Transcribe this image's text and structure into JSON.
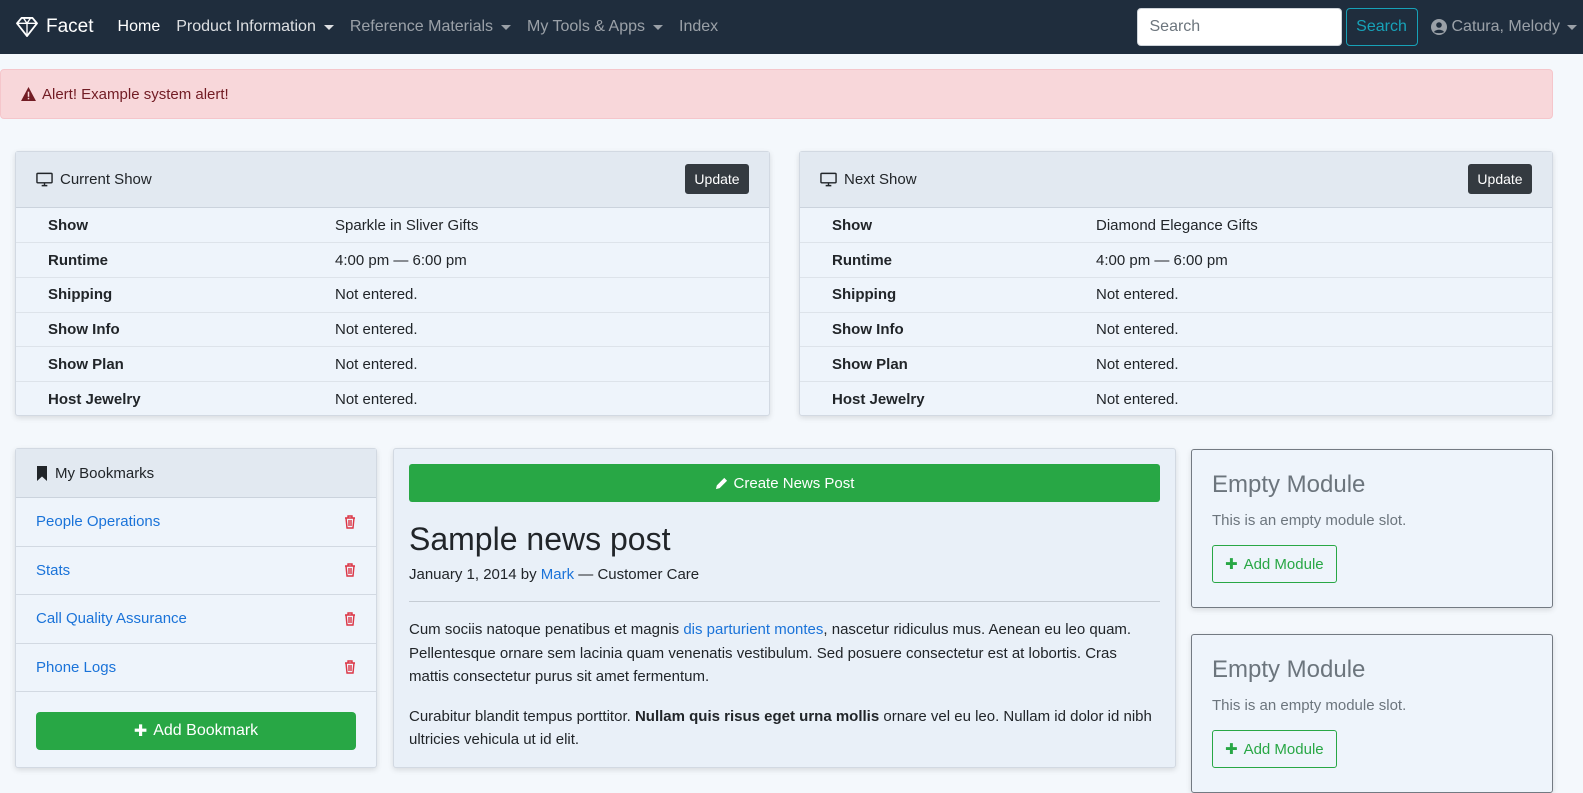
{
  "navbar": {
    "brand": "Facet",
    "links": [
      {
        "label": "Home"
      },
      {
        "label": "Product Information"
      },
      {
        "label": "Reference Materials"
      },
      {
        "label": "My Tools & Apps"
      },
      {
        "label": "Index"
      }
    ],
    "search_placeholder": "Search",
    "search_button": "Search",
    "user_name": "Catura, Melody"
  },
  "alert": {
    "text": "Alert! Example system alert!"
  },
  "current_show": {
    "title": "Current Show",
    "update_label": "Update",
    "rows": [
      {
        "label": "Show",
        "value": "Sparkle in Sliver Gifts"
      },
      {
        "label": "Runtime",
        "value": "4:00 pm — 6:00 pm"
      },
      {
        "label": "Shipping",
        "value": "Not entered."
      },
      {
        "label": "Show Info",
        "value": "Not entered."
      },
      {
        "label": "Show Plan",
        "value": "Not entered."
      },
      {
        "label": "Host Jewelry",
        "value": "Not entered."
      }
    ]
  },
  "next_show": {
    "title": "Next Show",
    "update_label": "Update",
    "rows": [
      {
        "label": "Show",
        "value": "Diamond Elegance Gifts"
      },
      {
        "label": "Runtime",
        "value": "4:00 pm — 6:00 pm"
      },
      {
        "label": "Shipping",
        "value": "Not entered."
      },
      {
        "label": "Show Info",
        "value": "Not entered."
      },
      {
        "label": "Show Plan",
        "value": "Not entered."
      },
      {
        "label": "Host Jewelry",
        "value": "Not entered."
      }
    ]
  },
  "bookmarks": {
    "title": "My Bookmarks",
    "items": [
      {
        "label": "People Operations"
      },
      {
        "label": "Stats"
      },
      {
        "label": "Call Quality Assurance"
      },
      {
        "label": "Phone Logs"
      }
    ],
    "add_label": "Add Bookmark"
  },
  "news": {
    "create_label": "Create News Post",
    "title": "Sample news post",
    "date": "January 1, 2014",
    "by": "by",
    "author": "Mark",
    "department": "— Customer Care",
    "p1_before": "Cum sociis natoque penatibus et magnis ",
    "p1_link": "dis parturient montes",
    "p1_after": ", nascetur ridiculus mus. Aenean eu leo quam. Pellentesque ornare sem lacinia quam venenatis vestibulum. Sed posuere consectetur est at lobortis. Cras mattis consectetur purus sit amet fermentum.",
    "p2_before": "Curabitur blandit tempus porttitor. ",
    "p2_bold": "Nullam quis risus eget urna mollis",
    "p2_after": " ornare vel eu leo. Nullam id dolor id nibh ultricies vehicula ut id elit."
  },
  "modules": [
    {
      "title": "Empty Module",
      "text": "This is an empty module slot.",
      "button": "Add Module"
    },
    {
      "title": "Empty Module",
      "text": "This is an empty module slot.",
      "button": "Add Module"
    }
  ],
  "colors": {
    "navbar_bg": "#1f2d3d",
    "alert_bg": "#f8d7da",
    "success": "#28a745",
    "info": "#17a2b8",
    "danger": "#dc3545",
    "link": "#1a73d9"
  },
  "icons": [
    "diamond-icon",
    "user-circle-icon",
    "warning-icon",
    "monitor-icon",
    "bookmark-icon",
    "trash-icon",
    "plus-icon",
    "pencil-icon"
  ]
}
